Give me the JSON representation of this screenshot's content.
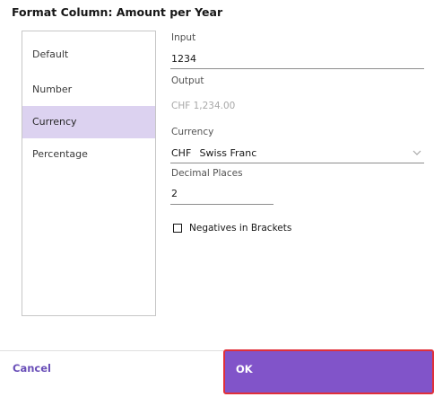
{
  "dialog": {
    "title": "Format Column: Amount per Year"
  },
  "format_list": {
    "items": [
      "Default",
      "Number",
      "Currency",
      "Percentage"
    ],
    "selected": "Currency"
  },
  "input": {
    "label": "Input",
    "value": "1234"
  },
  "output": {
    "label": "Output",
    "value": "CHF 1,234.00"
  },
  "currency": {
    "label": "Currency",
    "code": "CHF",
    "name": "Swiss Franc"
  },
  "decimal_places": {
    "label": "Decimal Places",
    "value": "2"
  },
  "negatives": {
    "label": "Negatives in Brackets",
    "checked": false
  },
  "footer": {
    "cancel_label": "Cancel",
    "ok_label": "OK"
  },
  "colors": {
    "accent": "#8154c9",
    "selected_bg": "#dcd2f0",
    "ok_outline": "#e0303a"
  }
}
